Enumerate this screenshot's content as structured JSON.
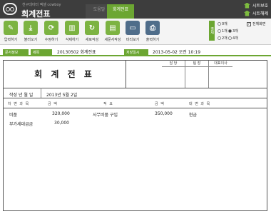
{
  "header": {
    "subtitle": "천구데이터 엑셀 cowboy",
    "title": "회계전표",
    "tabs": [
      {
        "label": "도움말",
        "active": false
      },
      {
        "label": "회계전표",
        "active": true
      }
    ],
    "sheet_protect_label": "시트보호",
    "sheet_release_label": "시트해제"
  },
  "toolbar": {
    "buttons": [
      {
        "label": "입력하기",
        "icon": "pencil-icon"
      },
      {
        "label": "불러오기",
        "icon": "download-icon"
      },
      {
        "label": "수정하기",
        "icon": "refresh-icon"
      },
      {
        "label": "삭제하기",
        "icon": "trash-icon"
      },
      {
        "label": "새로작성",
        "icon": "new-doc-icon"
      },
      {
        "label": "새문서작성",
        "icon": "document-icon"
      },
      {
        "label": "미리보기",
        "icon": "monitor-icon"
      },
      {
        "label": "출력하기",
        "icon": "printer-icon"
      }
    ],
    "scale_label": "결재",
    "radio_options": [
      {
        "label": "0개",
        "selected": false
      },
      {
        "label": "1개",
        "selected": false
      },
      {
        "label": "2개",
        "selected": false
      },
      {
        "label": "3개",
        "selected": true
      },
      {
        "label": "4개",
        "selected": false
      }
    ],
    "fullscreen_label": "전체화면",
    "fullscreen_checked": true
  },
  "info": {
    "doc_info_label": "문서정보",
    "subject_label": "제목",
    "subject_value": "20130502 회계전표",
    "saved_at_label": "저장일시",
    "saved_at_value": "2013-05-02 오전 10:19"
  },
  "document": {
    "title": "회 계 전 표",
    "approvals": [
      "담 당",
      "팀 장",
      "대표이사"
    ],
    "date_label": "작성 년 월 일",
    "date_value": "2013년 5월 2일",
    "headers": {
      "debit_account": "차 변 과 목",
      "debit_amount": "금   액",
      "summary": "적         요",
      "credit_amount": "금   액",
      "credit_account": "대 변 과 목"
    },
    "rows": [
      {
        "debit_account": "비품",
        "debit_amount": "320,000",
        "summary": "사무비품 구입",
        "credit_amount": "350,000",
        "credit_account": "현금"
      },
      {
        "debit_account": "부가세대급금",
        "debit_amount": "30,000",
        "summary": "",
        "credit_amount": "",
        "credit_account": ""
      }
    ]
  },
  "colors": {
    "accent_green": "#6ca632",
    "topbar_dark": "#3d3d3d"
  }
}
